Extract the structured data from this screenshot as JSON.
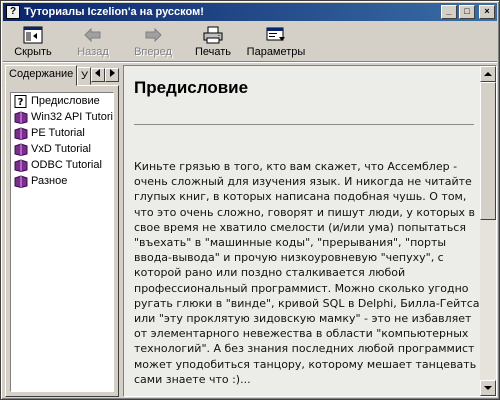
{
  "window": {
    "title": "Туториалы  Iczelion'a на русском!",
    "controls": {
      "minimize": "_",
      "maximize": "□",
      "close": "×"
    }
  },
  "toolbar": {
    "hide": "Скрыть",
    "back": "Назад",
    "forward": "Вперед",
    "print": "Печать",
    "options": "Параметры"
  },
  "tabs": {
    "contents": "Содержание",
    "index_partial": "У"
  },
  "tree": {
    "items": [
      {
        "label": "Предисловие",
        "icon": "help-page-icon"
      },
      {
        "label": "Win32 API Tutori",
        "icon": "book-icon"
      },
      {
        "label": "PE Tutorial",
        "icon": "book-icon"
      },
      {
        "label": "VxD Tutorial",
        "icon": "book-icon"
      },
      {
        "label": "ODBC Tutorial",
        "icon": "book-icon"
      },
      {
        "label": "Разное",
        "icon": "book-icon"
      }
    ]
  },
  "article": {
    "heading": "Предисловие",
    "paragraph": "Киньте грязью в того, кто вам скажет, что Ассемблер - очень сложный для изучения язык. И никогда не читайте глупых книг, в которых написана подобная чушь. О том, что это очень сложно, говорят и пишут люди, у которых в свое время не хватило смелости (и/или ума) попытаться \"въехать\" в \"машинные коды\", \"прерывания\", \"порты ввода-вывода\" и прочую низкоуровневую \"чепуху\", с которой рано или поздно сталкивается любой профессиональный программист. Можно сколько угодно ругать глюки в \"винде\", кривой SQL в Delphi, Билла-Гейтса или \"эту проклятую зидовскую мамку\" - это не избавляет от элементарного невежества в области \"компьютерных технологий\". А без знания последних любой программист может уподобиться танцору, которому мешает танцевать сами знаете что :)..."
  },
  "colors": {
    "titlebar_start": "#0a246a",
    "titlebar_end": "#3a6ea5",
    "book": "#7b2d8e"
  }
}
